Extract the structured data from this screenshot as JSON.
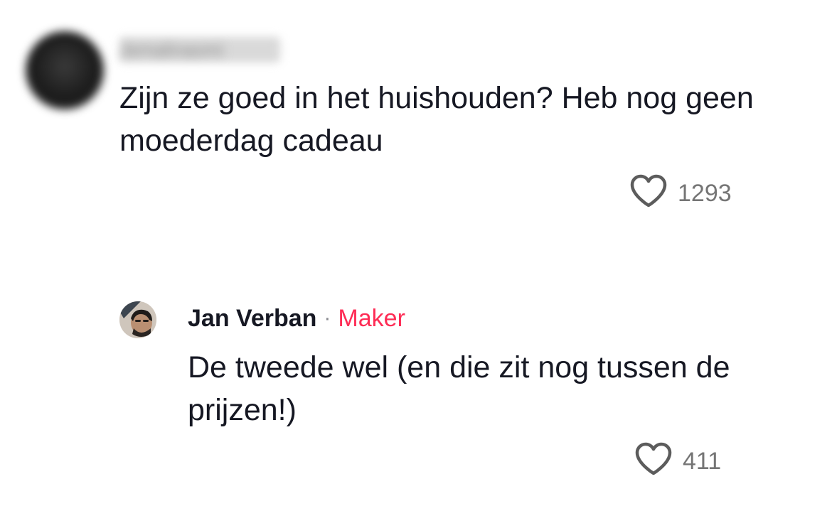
{
  "comment": {
    "username": "Jemalinaomi",
    "text": "Zijn ze goed in het huishouden? Heb nog geen moederdag cadeau",
    "likes": "1293",
    "icons": {
      "avatar": "blurred-avatar",
      "like": "heart-outline-icon"
    }
  },
  "reply": {
    "username": "Jan Verban",
    "separator": "·",
    "badge": "Maker",
    "text": "De tweede wel (en die zit nog tussen de prijzen!)",
    "likes": "411",
    "icons": {
      "avatar": "creator-avatar",
      "like": "heart-outline-icon"
    }
  },
  "colors": {
    "text_primary": "#161823",
    "text_secondary": "#757575",
    "badge": "#fe2c55",
    "heart_stroke": "#5c5c5c"
  }
}
